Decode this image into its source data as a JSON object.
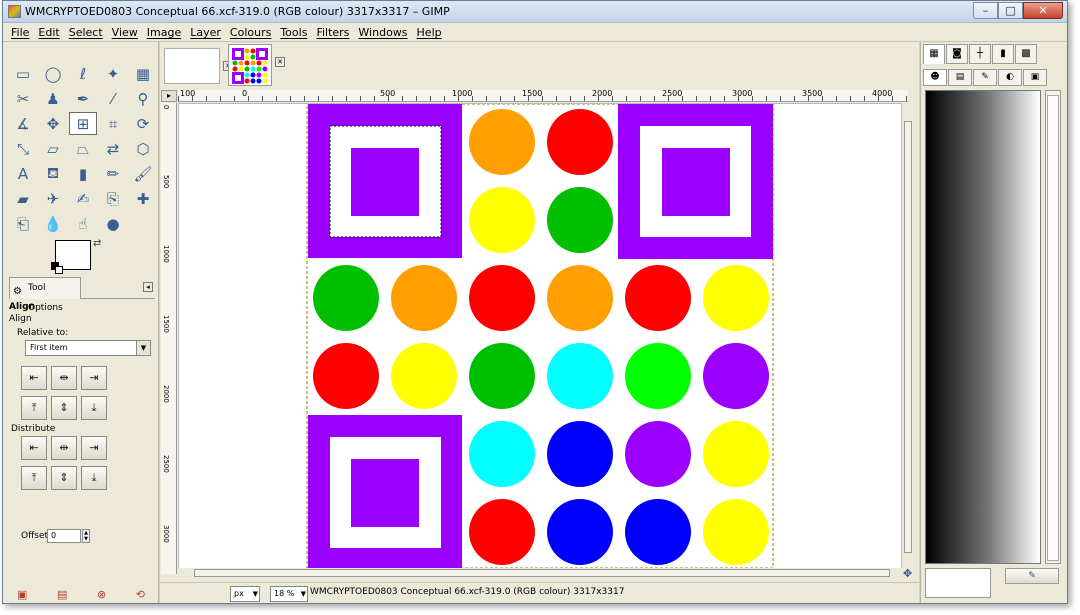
{
  "window": {
    "title": "WMCRYPTOED0803 Conceptual 66.xcf-319.0 (RGB colour) 3317x3317 – GIMP",
    "minimize": "–",
    "maximize": "□",
    "close": "✕"
  },
  "menu": [
    "File",
    "Edit",
    "Select",
    "View",
    "Image",
    "Layer",
    "Colours",
    "Tools",
    "Filters",
    "Windows",
    "Help"
  ],
  "toolbox": {
    "tools": [
      {
        "name": "rect-select-icon",
        "glyph": "▭"
      },
      {
        "name": "ellipse-select-icon",
        "glyph": "◯"
      },
      {
        "name": "free-select-icon",
        "glyph": "ℓ"
      },
      {
        "name": "fuzzy-select-icon",
        "glyph": "✦"
      },
      {
        "name": "color-select-icon",
        "glyph": "▦"
      },
      {
        "name": "scissors-select-icon",
        "glyph": "✂"
      },
      {
        "name": "foreground-select-icon",
        "glyph": "♟"
      },
      {
        "name": "paths-icon",
        "glyph": "✒"
      },
      {
        "name": "color-picker-icon",
        "glyph": "⁄"
      },
      {
        "name": "zoom-icon",
        "glyph": "⚲"
      },
      {
        "name": "measure-icon",
        "glyph": "∡"
      },
      {
        "name": "move-icon",
        "glyph": "✥"
      },
      {
        "name": "align-icon",
        "glyph": "⊞"
      },
      {
        "name": "crop-icon",
        "glyph": "⌗"
      },
      {
        "name": "rotate-icon",
        "glyph": "⟳"
      },
      {
        "name": "scale-icon",
        "glyph": "⤡"
      },
      {
        "name": "shear-icon",
        "glyph": "▱"
      },
      {
        "name": "perspective-icon",
        "glyph": "⏢"
      },
      {
        "name": "flip-icon",
        "glyph": "⇄"
      },
      {
        "name": "cage-icon",
        "glyph": "⬡"
      },
      {
        "name": "text-icon",
        "glyph": "A"
      },
      {
        "name": "bucket-fill-icon",
        "glyph": "⛾"
      },
      {
        "name": "blend-icon",
        "glyph": "▮"
      },
      {
        "name": "pencil-icon",
        "glyph": "✏"
      },
      {
        "name": "paintbrush-icon",
        "glyph": "🖌"
      },
      {
        "name": "eraser-icon",
        "glyph": "▰"
      },
      {
        "name": "airbrush-icon",
        "glyph": "✈"
      },
      {
        "name": "ink-icon",
        "glyph": "✍"
      },
      {
        "name": "clone-icon",
        "glyph": "⎘"
      },
      {
        "name": "heal-icon",
        "glyph": "✚"
      },
      {
        "name": "perspective-clone-icon",
        "glyph": "⎗"
      },
      {
        "name": "blur-icon",
        "glyph": "💧"
      },
      {
        "name": "smudge-icon",
        "glyph": "☝"
      },
      {
        "name": "dodge-burn-icon",
        "glyph": "●"
      }
    ],
    "active_tool_index": 12,
    "tab_label": "Tool Options",
    "opt_heading": "Align",
    "opt_sub": "Align",
    "relative_label": "Relative to:",
    "relative_value": "First item",
    "distribute_label": "Distribute",
    "offset_label": "Offset:",
    "offset_value": "0",
    "align_buttons": [
      "⇤",
      "⇹",
      "⇥",
      "⤒",
      "⇕",
      "⤓"
    ],
    "distribute_buttons": [
      "⇤",
      "⇹",
      "⇥",
      "⤒",
      "⇕",
      "⤓"
    ],
    "bottom_icons": [
      "save-options-icon",
      "restore-options-icon",
      "delete-options-icon",
      "reset-options-icon"
    ]
  },
  "image_window": {
    "ruler_labels": [
      "100",
      "0",
      "500",
      "1000",
      "1500",
      "2000",
      "2500",
      "3000",
      "3500",
      "4000"
    ],
    "vruler_labels": [
      "0",
      "500",
      "1000",
      "1500",
      "2000",
      "2500",
      "3000"
    ],
    "unit": "px",
    "zoom": "18 %",
    "status_text": "WMCRYPTOED0803 Conceptual 66.xcf-319.0 (RGB colour) 3317x3317",
    "colors": {
      "purple": "#9b00ff",
      "orange": "#ff9f00",
      "red": "#ff0000",
      "yellow": "#ffff00",
      "green": "#00bf00",
      "cyan": "#00ffff",
      "lime": "#00ff00",
      "blue": "#0000ff"
    },
    "circle_rows": [
      [
        "_",
        "_",
        "orange",
        "red",
        "_",
        "_"
      ],
      [
        "_",
        "_",
        "yellow",
        "green",
        "_",
        "_"
      ],
      [
        "green",
        "orange",
        "red",
        "orange",
        "red",
        "yellow"
      ],
      [
        "red",
        "yellow",
        "green",
        "cyan",
        "lime",
        "purple"
      ],
      [
        "_",
        "_",
        "cyan",
        "blue",
        "purple",
        "yellow"
      ],
      [
        "_",
        "_",
        "red",
        "blue",
        "blue",
        "yellow"
      ]
    ]
  },
  "dock": {
    "top_tabs": [
      "▦",
      "◙",
      "┼",
      "▮",
      "▩"
    ],
    "second_tabs": [
      "☻",
      "▤",
      "✎",
      "◐",
      "▣"
    ]
  }
}
